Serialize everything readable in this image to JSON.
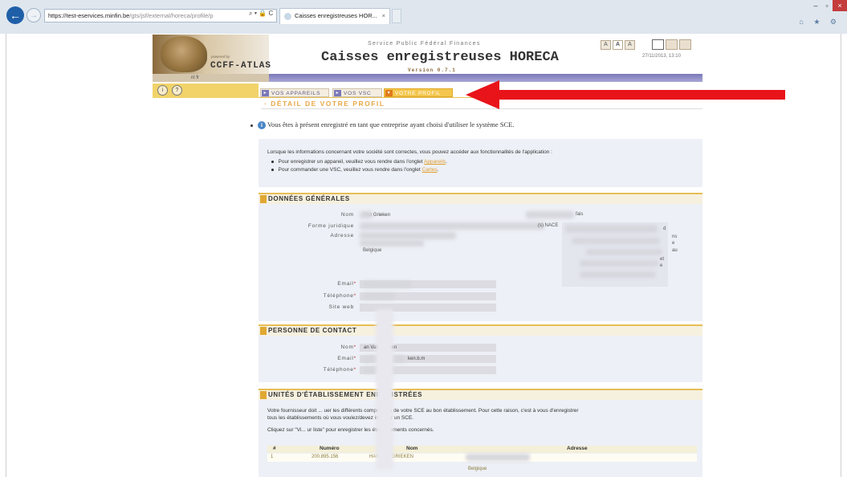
{
  "browser": {
    "url_dark": "https://test-eservices.minfin.be",
    "url_light": "/gts/jsf/external/horeca/profile/p",
    "address_icons": "⌕ ▾ 🔒 C",
    "tab_title": "Caisses enregistreuses HOR...",
    "tab_close": "×",
    "controls": [
      "–",
      "▫",
      "×"
    ],
    "icons": "⌂ ★ ⚙"
  },
  "app": {
    "powered_by": "powered by",
    "logo_text": "CCFF-ATLAS",
    "service_label": "Service Public Fédéral Finances",
    "title": "Caisses enregistreuses HORECA",
    "version": "Version 0.7.1",
    "date": "27/11/2013, 13:10",
    "font_sizes": [
      "A",
      "A",
      "A"
    ],
    "languages": "nl     fr"
  },
  "nav": {
    "tabs": [
      {
        "label": "VOS APPAREILS"
      },
      {
        "label": "VOS VSC"
      },
      {
        "label": "VOTRE PROFIL",
        "active": true
      }
    ],
    "heading": "· DÉTAIL DE VOTRE PROFIL"
  },
  "annotation_color": "#e8141a",
  "message": "Vous êtes à présent enregistré en tant que entreprise ayant choisi d'utiliser le système SCE.",
  "info_box": {
    "intro": "Lorsque les informations concernant votre société sont correctes, vous pouvez accéder aux fonctionnalités de l'application :",
    "line1_prefix": "Pour enregistrer un appareil, veuillez vous rendre dans l'onglet ",
    "line1_link": "Appareils",
    "line1_suffix": ".",
    "line2_prefix": "Pour commander une VSC, veuillez vous rendre dans l'onglet ",
    "line2_link": "Cartes",
    "line2_suffix": "."
  },
  "general": {
    "title": "DONNÉES GÉNÉRALES",
    "labels": {
      "nom": "Nom",
      "forme": "Forme juridique",
      "adresse": "Adresse",
      "email": "Email",
      "telephone": "Téléphone",
      "site": "Site web",
      "required": "*"
    },
    "values": {
      "nom": "Van Grieken",
      "nace_label": "(s) NACE",
      "country": "Belgique",
      "right_fragment": "fais",
      "note_a": "d",
      "note_b": "ns",
      "note_c": "e",
      "note_d": "au",
      "note_e": "et",
      "note_f": "e"
    }
  },
  "contact": {
    "title": "PERSONNE DE CONTACT",
    "nom_value": "an Van Grieken",
    "email_value": "ken.b.m",
    "labels": {
      "nom": "Nom",
      "email": "Email",
      "telephone": "Téléphone"
    }
  },
  "establishments": {
    "title": "UNITÉS D'ÉTABLISSEMENT ENREGISTRÉES",
    "text1": "Votre fournisseur doit ... uer les différents composants de votre SCE au bon établissement. Pour cette raison, c'est à vous d'enregistrer",
    "text2": "tous les établissements où vous voulez/devez installer un SCE.",
    "text3": "Cliquez sur \"Vi...   ur liste\" pour enregistrer les établissements concernés.",
    "columns": [
      "#",
      "Numéro",
      "Nom",
      "Adresse"
    ],
    "rows": [
      {
        "index": "1",
        "numero": "200.895.156",
        "nom": "HAN VAN GRIEKEN",
        "adresse": "Belgique"
      }
    ]
  }
}
